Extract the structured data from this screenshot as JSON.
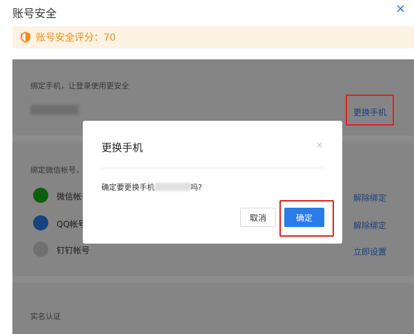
{
  "header": {
    "title": "账号安全",
    "close_icon": "×"
  },
  "score": {
    "label": "账号安全评分：70"
  },
  "phone_section": {
    "description": "绑定手机，让登录使用更安全",
    "change_link": "更换手机"
  },
  "social_section": {
    "description": "绑定微信帐号，",
    "items": [
      {
        "label": "微信帐号",
        "action": "解除绑定",
        "icon": "wechat-icon",
        "color": "#1aad19"
      },
      {
        "label": "QQ帐号",
        "action": "解除绑定",
        "icon": "qq-icon",
        "color": "#2b7be9"
      },
      {
        "label": "钉钉帐号",
        "action": "立即设置",
        "icon": "dingtalk-icon",
        "color": "#cccccc"
      }
    ]
  },
  "realname_section": {
    "label": "实名认证"
  },
  "modal": {
    "title": "更换手机",
    "close_icon": "×",
    "message_prefix": "确定要更换手机",
    "message_suffix": "吗?",
    "cancel_label": "取消",
    "ok_label": "确定"
  },
  "colors": {
    "accent": "#2b7be9",
    "warning": "#f08c1e",
    "highlight_box": "#e02020"
  }
}
